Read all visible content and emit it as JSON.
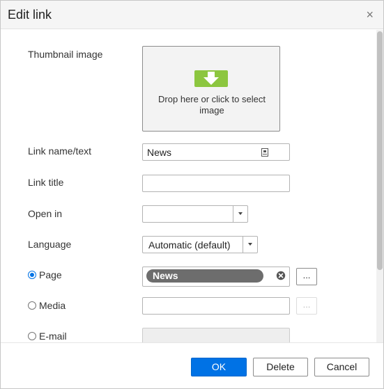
{
  "dialog": {
    "title": "Edit link",
    "close_label": "×"
  },
  "form": {
    "thumbnail": {
      "label": "Thumbnail image",
      "drop_text": "Drop here or click to select image"
    },
    "link_name": {
      "label": "Link name/text",
      "value": "News"
    },
    "link_title": {
      "label": "Link title",
      "value": ""
    },
    "open_in": {
      "label": "Open in",
      "selected": ""
    },
    "language": {
      "label": "Language",
      "selected": "Automatic (default)"
    },
    "page": {
      "label": "Page",
      "checked": true,
      "chip": "News",
      "browse_label": "..."
    },
    "media": {
      "label": "Media",
      "checked": false,
      "value": "",
      "browse_label": "..."
    },
    "email": {
      "label": "E-mail",
      "checked": false,
      "value": ""
    }
  },
  "footer": {
    "ok_label": "OK",
    "delete_label": "Delete",
    "cancel_label": "Cancel"
  },
  "colors": {
    "primary": "#0072e5",
    "upload_icon": "#8cc63f",
    "chip_bg": "#6d6d6d"
  },
  "icons": {
    "close": "close-icon",
    "upload": "upload-arrow-icon",
    "lock": "lock-icon",
    "dropdown": "chevron-down-icon",
    "clear": "clear-circle-icon"
  }
}
